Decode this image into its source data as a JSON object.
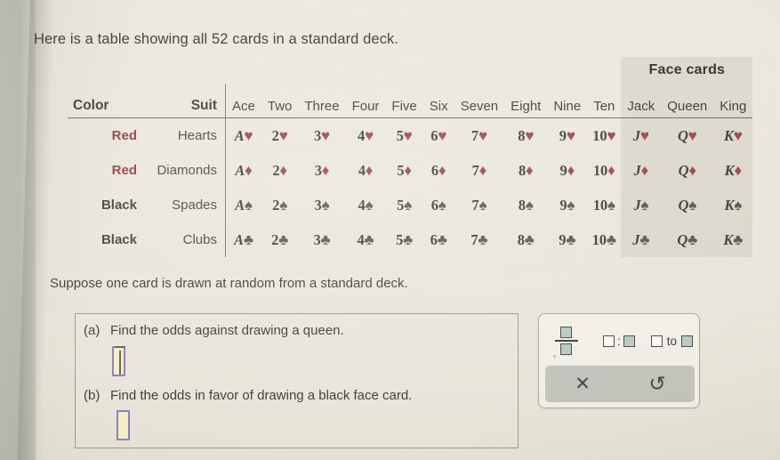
{
  "intro": "Here is a table showing all 52 cards in a standard deck.",
  "table": {
    "face_cards_header": "Face cards",
    "headers": {
      "color": "Color",
      "suit": "Suit",
      "ranks": [
        "Ace",
        "Two",
        "Three",
        "Four",
        "Five",
        "Six",
        "Seven",
        "Eight",
        "Nine",
        "Ten",
        "Jack",
        "Queen",
        "King"
      ]
    },
    "rank_symbols": [
      "A",
      "2",
      "3",
      "4",
      "5",
      "6",
      "7",
      "8",
      "9",
      "10",
      "J",
      "Q",
      "K"
    ],
    "rows": [
      {
        "color": "Red",
        "suit": "Hearts",
        "pip": "♥",
        "tone": "red",
        "suit_name": "hearts-row"
      },
      {
        "color": "Red",
        "suit": "Diamonds",
        "pip": "♦",
        "tone": "red",
        "suit_name": "diamonds-row"
      },
      {
        "color": "Black",
        "suit": "Spades",
        "pip": "♠",
        "tone": "black",
        "suit_name": "spades-row"
      },
      {
        "color": "Black",
        "suit": "Clubs",
        "pip": "♣",
        "tone": "black",
        "suit_name": "clubs-row"
      }
    ],
    "colors": {
      "red": "#9c4046",
      "black": "#56544e"
    }
  },
  "suppose": "Suppose one card is drawn at random from a standard deck.",
  "questions": {
    "a": {
      "label": "(a)",
      "text": "Find the odds against drawing a queen.",
      "answer_value": ""
    },
    "b": {
      "label": "(b)",
      "text": "Find the odds in favor of drawing a black face card.",
      "answer_value": ""
    }
  },
  "toolbar": {
    "fraction_label": "fraction-template",
    "ratio_separator": ":",
    "to_word": "to",
    "clear_glyph": "✕",
    "undo_glyph": "↺"
  }
}
